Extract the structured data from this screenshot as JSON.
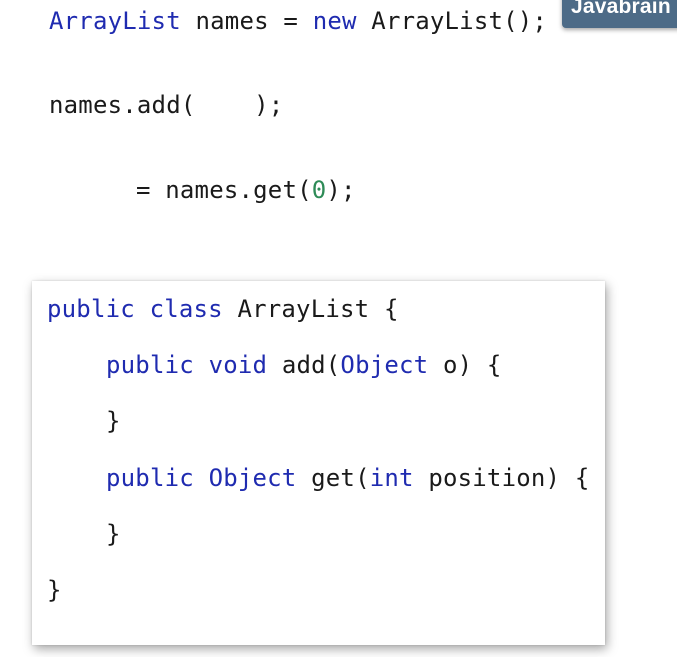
{
  "badge": {
    "text": "Javabrain"
  },
  "usage": {
    "line1": {
      "type": "ArrayList",
      "var_assign": " names = ",
      "new_kw": "new",
      "ctor": " ArrayList();"
    },
    "line2": {
      "text": "names.add(    );"
    },
    "line3": {
      "pre": "   = names.get(",
      "index": "0",
      "post": ");"
    }
  },
  "class_def": {
    "line1": {
      "public_kw": "public",
      "class_kw": "class",
      "name": " ArrayList {"
    },
    "line2": {
      "public_kw": "public",
      "void_kw": "void",
      "method_pre": " add(",
      "object_type": "Object",
      "method_post": " o) {"
    },
    "line3": {
      "brace": "}"
    },
    "line4": {
      "public_kw": "public",
      "object_type": "Object",
      "method_pre": " get(",
      "int_kw": "int",
      "method_post": " position) {"
    },
    "line5": {
      "brace": "}"
    },
    "line6": {
      "brace": "}"
    }
  },
  "colors": {
    "keyword": "#1f2bb0",
    "number": "#2e8b57",
    "text": "#1a1a1a",
    "badge_bg": "#4d6b87"
  }
}
